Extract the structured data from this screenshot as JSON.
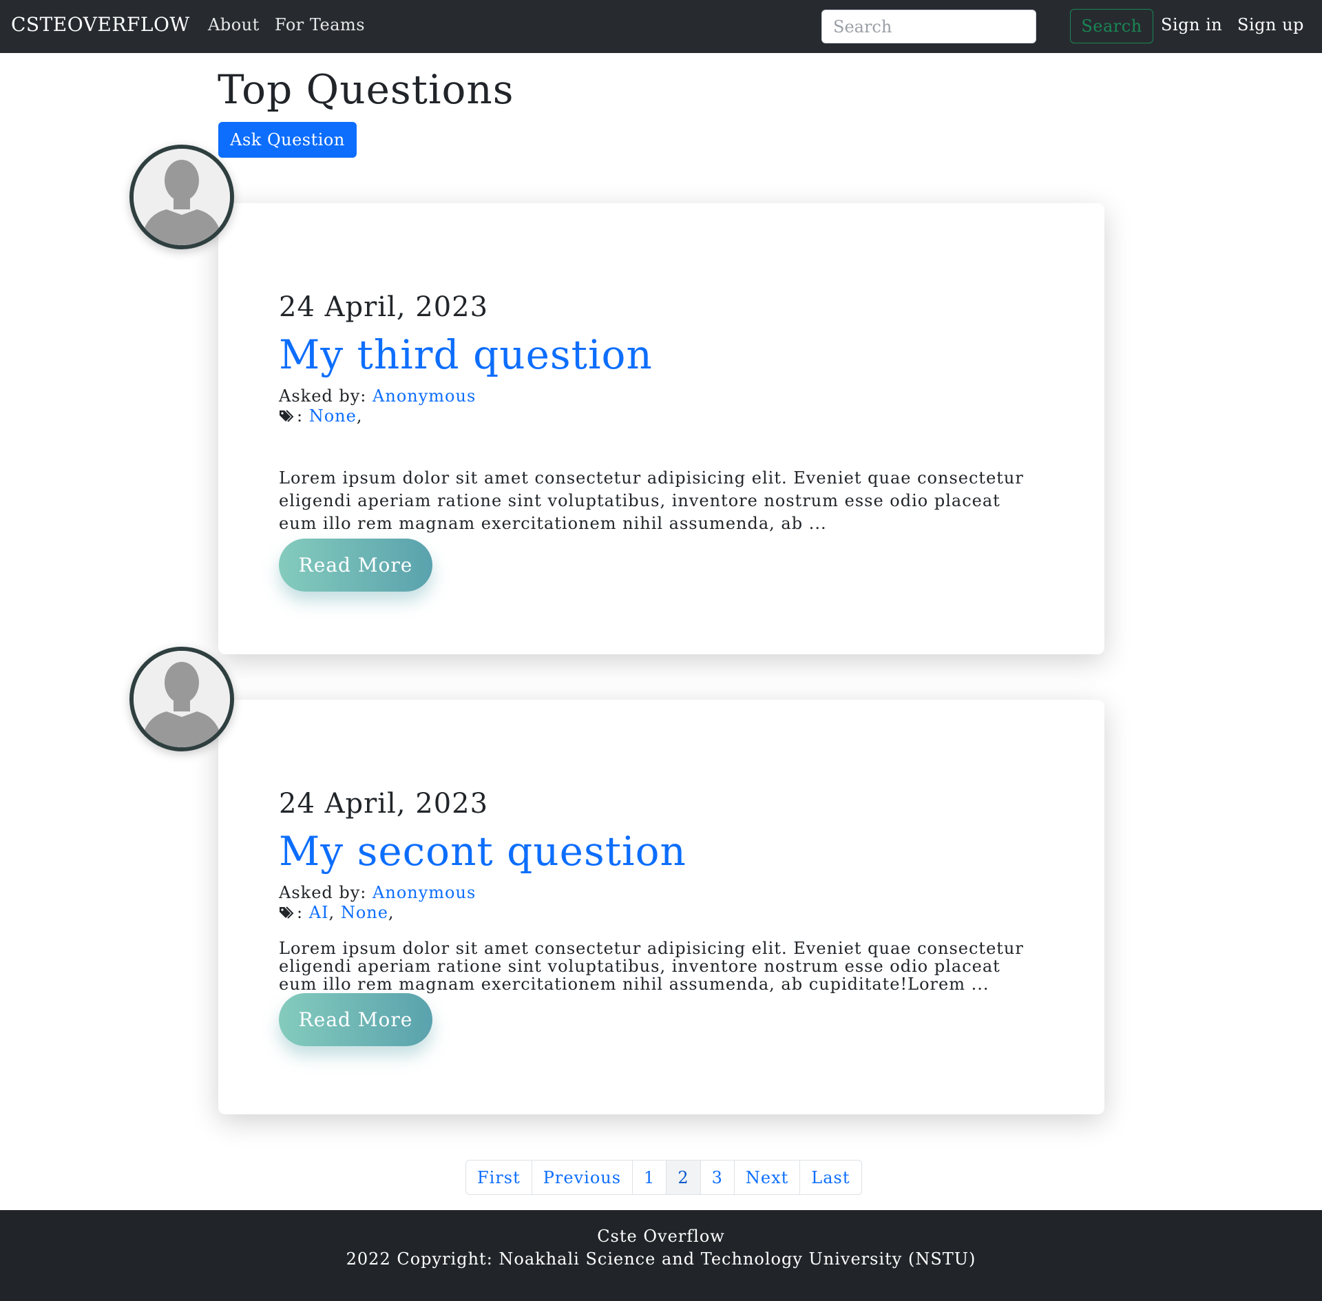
{
  "navbar": {
    "brand": "CSTEOVERFLOW",
    "links": {
      "about": "About",
      "teams": "For Teams"
    },
    "search": {
      "placeholder": "Search",
      "value": "",
      "button_label": "Search"
    },
    "sign_in": "Sign in",
    "sign_up": "Sign up"
  },
  "main": {
    "title": "Top Questions",
    "ask_button": "Ask Question"
  },
  "questions": [
    {
      "date": "24 April, 2023",
      "title": "My third question",
      "asked_label": "Asked by:",
      "author": "Anonymous",
      "tags_prefix": ":",
      "tags": [
        "None"
      ],
      "excerpt": "Lorem ipsum dolor sit amet consectetur adipisicing elit. Eveniet quae consectetur eligendi aperiam ratione sint voluptatibus, inventore nostrum esse odio placeat eum illo rem magnam exercitationem nihil assumenda, ab ...",
      "read_more": "Read More",
      "avatar_icon": "user-silhouette-icon"
    },
    {
      "date": "24 April, 2023",
      "title": "My secont question",
      "asked_label": "Asked by:",
      "author": "Anonymous",
      "tags_prefix": ":",
      "tags": [
        "AI",
        "None"
      ],
      "excerpt": "Lorem ipsum dolor sit amet consectetur adipisicing elit. Eveniet quae consectetur eligendi aperiam ratione sint voluptatibus, inventore nostrum esse odio placeat eum illo rem magnam exercitationem nihil assumenda, ab cupiditate!Lorem ...",
      "read_more": "Read More",
      "avatar_icon": "user-silhouette-icon"
    }
  ],
  "pagination": {
    "first": "First",
    "previous": "Previous",
    "pages": [
      "1",
      "2",
      "3"
    ],
    "active_page": "2",
    "next": "Next",
    "last": "Last"
  },
  "footer": {
    "name": "Cste Overflow",
    "copyright": "2022 Copyright: Noakhali Science and Technology University (NSTU)"
  },
  "colors": {
    "navbar_bg": "#272b30",
    "primary": "#0d6efd",
    "success": "#198754",
    "read_more_gradient": [
      "#84cbbd",
      "#5aa2ad"
    ],
    "footer_bg": "#212529"
  }
}
